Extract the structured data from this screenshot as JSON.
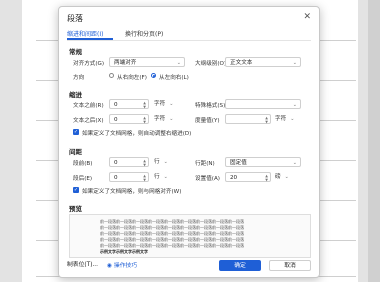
{
  "dialog": {
    "title": "段落",
    "close_glyph": "✕",
    "tabs": [
      {
        "label": "缩进和间距(I)",
        "active": true
      },
      {
        "label": "换行和分页(P)",
        "active": false
      }
    ]
  },
  "general": {
    "heading": "常规",
    "alignment_label": "对齐方式(G)",
    "alignment_value": "两端对齐",
    "outline_label": "大纲级别(O)",
    "outline_value": "正文文本",
    "direction_label": "方向",
    "direction_options": [
      "从右向左(F)",
      "从左向右(L)"
    ],
    "direction_selected": 1
  },
  "indent": {
    "heading": "缩进",
    "before_label": "文本之前(R)",
    "before_value": "0",
    "before_unit": "字符",
    "special_label": "特殊格式(S)",
    "special_value": "",
    "after_label": "文本之后(X)",
    "after_value": "0",
    "after_unit": "字符",
    "measure_label": "度量值(Y)",
    "measure_value": "",
    "measure_unit": "字符",
    "grid_checkbox": "如果定义了文档网格，则自动调整右缩进(D)",
    "grid_checked": true
  },
  "spacing": {
    "heading": "间距",
    "before_label": "段前(B)",
    "before_value": "0",
    "before_unit": "行",
    "line_label": "行距(N)",
    "line_value": "固定值",
    "after_label": "段后(E)",
    "after_value": "0",
    "after_unit": "行",
    "setting_label": "设置值(A)",
    "setting_value": "20",
    "setting_unit": "磅",
    "grid_checkbox": "如果定义了文档网格，则与网格对齐(W)",
    "grid_checked": true
  },
  "preview": {
    "heading": "预览",
    "sample_line": "前一段落前一段落前一段落前一段落前一段落前一段落前一段落前一段落前一段落",
    "current_line": "示例文字示例文字示例文字"
  },
  "footer": {
    "tabs_button": "制表位(T)...",
    "tips_link": "操作技巧",
    "ok_button": "确定",
    "cancel_button": "取消"
  },
  "colors": {
    "accent": "#1f5fd6"
  }
}
